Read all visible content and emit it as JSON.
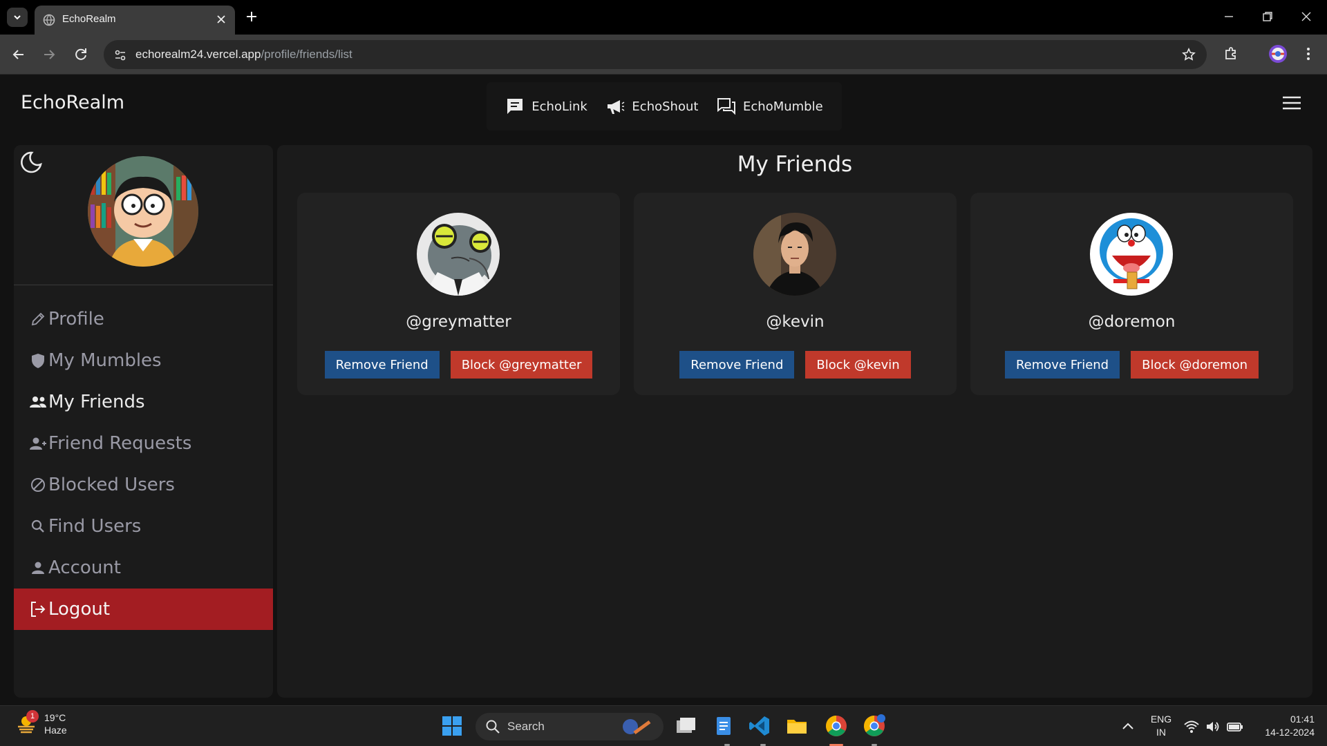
{
  "browser": {
    "tab_title": "EchoRealm",
    "url_host": "echorealm24.vercel.app",
    "url_path": "/profile/friends/list"
  },
  "app": {
    "brand": "EchoRealm",
    "nav": [
      {
        "label": "EchoLink",
        "icon": "chat-bubble-icon"
      },
      {
        "label": "EchoShout",
        "icon": "megaphone-icon"
      },
      {
        "label": "EchoMumble",
        "icon": "chat-bubbles-icon"
      }
    ]
  },
  "sidebar": {
    "items": [
      {
        "label": "Profile",
        "icon": "pencil-icon"
      },
      {
        "label": "My Mumbles",
        "icon": "shield-icon"
      },
      {
        "label": "My Friends",
        "icon": "users-icon",
        "active": true
      },
      {
        "label": "Friend Requests",
        "icon": "user-plus-icon"
      },
      {
        "label": "Blocked Users",
        "icon": "block-icon"
      },
      {
        "label": "Find Users",
        "icon": "search-icon"
      },
      {
        "label": "Account",
        "icon": "user-icon"
      },
      {
        "label": "Logout",
        "icon": "logout-icon"
      }
    ]
  },
  "main": {
    "title": "My Friends",
    "friends": [
      {
        "username": "@greymatter",
        "remove_label": "Remove Friend",
        "block_label": "Block @greymatter"
      },
      {
        "username": "@kevin",
        "remove_label": "Remove Friend",
        "block_label": "Block @kevin"
      },
      {
        "username": "@doremon",
        "remove_label": "Remove Friend",
        "block_label": "Block @doremon"
      }
    ]
  },
  "taskbar": {
    "weather_temp": "19°C",
    "weather_desc": "Haze",
    "weather_badge": "1",
    "search_placeholder": "Search",
    "lang_top": "ENG",
    "lang_bottom": "IN",
    "time": "01:41",
    "date": "14-12-2024"
  },
  "colors": {
    "page_bg": "#121212",
    "panel_bg": "#1b1b1b",
    "card_bg": "#222222",
    "remove_button": "#1e5088",
    "block_button": "#c0392b",
    "logout_bg": "#a31d22"
  }
}
